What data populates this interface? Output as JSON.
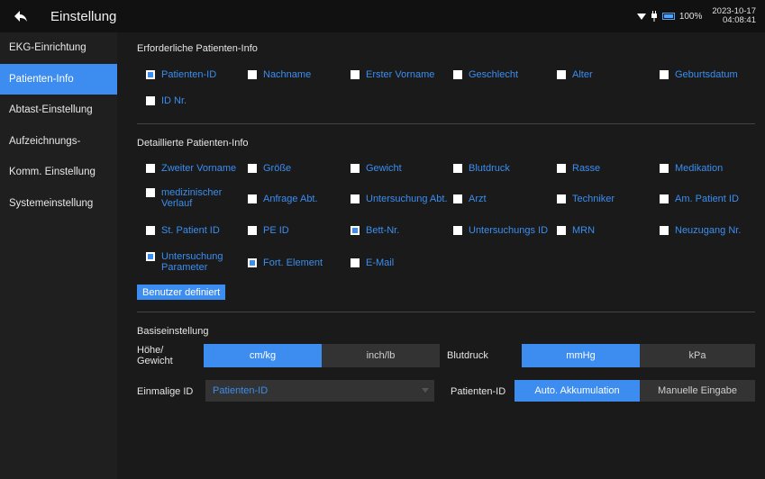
{
  "header": {
    "title": "Einstellung",
    "battery": "100%",
    "date": "2023-10-17",
    "time": "04:08:41"
  },
  "sidebar": {
    "items": [
      {
        "label": "EKG-Einrichtung"
      },
      {
        "label": "Patienten-Info"
      },
      {
        "label": "Abtast-Einstellung"
      },
      {
        "label": "Aufzeichnungs-"
      },
      {
        "label": "Komm. Einstellung"
      },
      {
        "label": "Systemeinstellung"
      }
    ]
  },
  "required": {
    "title": "Erforderliche Patienten-Info",
    "items": [
      {
        "label": "Patienten-ID",
        "checked": true
      },
      {
        "label": "Nachname",
        "checked": false
      },
      {
        "label": "Erster Vorname",
        "checked": false
      },
      {
        "label": "Geschlecht",
        "checked": false
      },
      {
        "label": "Alter",
        "checked": false
      },
      {
        "label": "Geburtsdatum",
        "checked": false
      },
      {
        "label": "ID Nr.",
        "checked": false
      }
    ]
  },
  "detailed": {
    "title": "Detaillierte Patienten-Info",
    "items": [
      {
        "label": "Zweiter Vorname",
        "checked": false
      },
      {
        "label": "Größe",
        "checked": false
      },
      {
        "label": "Gewicht",
        "checked": false
      },
      {
        "label": "Blutdruck",
        "checked": false
      },
      {
        "label": "Rasse",
        "checked": false
      },
      {
        "label": "Medikation",
        "checked": false
      },
      {
        "label": "medizinischer Verlauf",
        "checked": false
      },
      {
        "label": "Anfrage Abt.",
        "checked": false
      },
      {
        "label": "Untersuchung Abt.",
        "checked": false
      },
      {
        "label": "Arzt",
        "checked": false
      },
      {
        "label": "Techniker",
        "checked": false
      },
      {
        "label": "Am. Patient ID",
        "checked": false
      },
      {
        "label": "St. Patient ID",
        "checked": false
      },
      {
        "label": "PE ID",
        "checked": false
      },
      {
        "label": "Bett-Nr.",
        "checked": true
      },
      {
        "label": "Untersuchungs ID",
        "checked": false
      },
      {
        "label": "MRN",
        "checked": false
      },
      {
        "label": "Neuzugang Nr.",
        "checked": false
      },
      {
        "label": "Untersuchung Parameter",
        "checked": true
      },
      {
        "label": "Fort. Element",
        "checked": true
      },
      {
        "label": "E-Mail",
        "checked": false
      }
    ],
    "custom_button": "Benutzer definiert"
  },
  "basic": {
    "title": "Basiseinstellung",
    "height_weight_label": "Höhe/ Gewicht",
    "height_weight_options": [
      {
        "label": "cm/kg",
        "selected": true
      },
      {
        "label": "inch/lb",
        "selected": false
      }
    ],
    "bp_label": "Blutdruck",
    "bp_options": [
      {
        "label": "mmHg",
        "selected": true
      },
      {
        "label": "kPa",
        "selected": false
      }
    ],
    "single_id_label": "Einmalige ID",
    "single_id_value": "Patienten-ID",
    "patient_id_label": "Patienten-ID",
    "patient_id_options": [
      {
        "label": "Auto. Akkumulation",
        "selected": true
      },
      {
        "label": "Manuelle Eingabe",
        "selected": false
      }
    ]
  },
  "colors": {
    "accent": "#3d8df0",
    "background": "#1a1a1a",
    "sidebar": "#1f1f1f",
    "topbar": "#111111"
  }
}
